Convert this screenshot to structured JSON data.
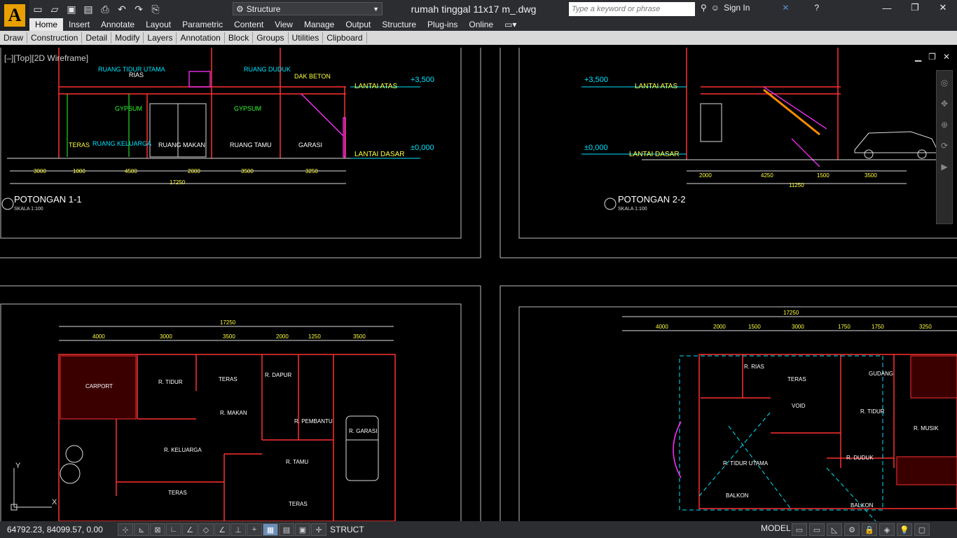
{
  "app": {
    "title": "rumah tinggal 11x17 m_.dwg",
    "workspace": "Structure",
    "search_placeholder": "Type a keyword or phrase",
    "signin": "Sign In"
  },
  "menu": {
    "tabs": [
      "Home",
      "Insert",
      "Annotate",
      "Layout",
      "Parametric",
      "Content",
      "View",
      "Manage",
      "Output",
      "Structure",
      "Plug-ins",
      "Online"
    ],
    "active": "Home"
  },
  "panels": [
    "Draw",
    "Construction",
    "Detail",
    "Modify",
    "Layers",
    "Annotation",
    "Block",
    "Groups",
    "Utilities",
    "Clipboard"
  ],
  "viewport": {
    "label": "[–][Top][2D Wireframe]"
  },
  "drawing": {
    "section1": {
      "title": "POTONGAN  1-1",
      "scale": "SKALA 1:100",
      "rooms": [
        "RUANG TIDUR UTAMA",
        "RIAS",
        "RUANG DUDUK",
        "DAK BETON",
        "GYPSUM",
        "GYPSUM",
        "TERAS",
        "RUANG KELUARGA",
        "RUANG MAKAN",
        "RUANG TAMU",
        "GARASI"
      ],
      "levels": [
        "LANTAI ATAS",
        "LANTAI DASAR",
        "+3,500",
        "±0,000"
      ],
      "dims": [
        "3000",
        "1000",
        "4500",
        "2000",
        "3500",
        "3250",
        "17250"
      ]
    },
    "section2": {
      "title": "POTONGAN  2-2",
      "scale": "SKALA 1:100",
      "levels": [
        "LANTAI ATAS",
        "LANTAI DASAR",
        "+3,500",
        "±0,000"
      ],
      "dims": [
        "2000",
        "4250",
        "1500",
        "3500",
        "11250"
      ]
    },
    "plan1": {
      "dims": [
        "17250",
        "4000",
        "3000",
        "3500",
        "2000",
        "1250",
        "3500"
      ],
      "rooms": [
        "CARPORT",
        "R. TIDUR",
        "TERAS",
        "R. DAPUR",
        "R. MAKAN",
        "R. PEMBANTU",
        "R. GARASI",
        "R. KELUARGA",
        "R. TAMU",
        "TERAS",
        "TERAS"
      ]
    },
    "plan2": {
      "dims": [
        "17250",
        "4000",
        "2000",
        "1500",
        "3000",
        "1750",
        "1750",
        "3250"
      ],
      "rooms": [
        "R. RIAS",
        "TERAS",
        "GUDANG",
        "R. TIDUR",
        "R. MUSIK",
        "R. TIDUR UTAMA",
        "R. DUDUK",
        "BALKON",
        "BALKON",
        "VOID"
      ]
    }
  },
  "status": {
    "coords": "64792.23, 84099.57, 0.00",
    "struct": "STRUCT",
    "model": "MODEL"
  }
}
